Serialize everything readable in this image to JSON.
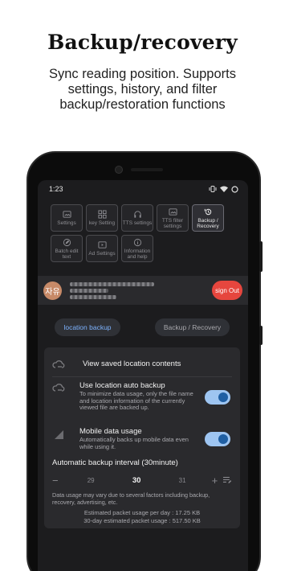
{
  "promo": {
    "title": "Backup/recovery",
    "subtitle": "Sync reading position. Supports settings, history, and filter backup/restoration functions"
  },
  "status_bar": {
    "time": "1:23"
  },
  "menu": {
    "items": [
      {
        "label": "Settings",
        "icon": "image-icon"
      },
      {
        "label": "key Setting",
        "icon": "grid-icon"
      },
      {
        "label": "TTS settings",
        "icon": "headphones-icon"
      },
      {
        "label": "TTS filter settings",
        "icon": "image-icon"
      },
      {
        "label": "Backup / Recovery",
        "icon": "restore-icon",
        "active": true
      },
      {
        "label": "Batch edit text",
        "icon": "edit-cycle-icon"
      },
      {
        "label": "Ad Settings",
        "icon": "play-box-icon"
      },
      {
        "label": "Information and help",
        "icon": "info-icon"
      }
    ]
  },
  "account": {
    "avatar_text": "자유",
    "sign_out_label": "sign Out"
  },
  "tabs": {
    "location_backup": "location backup",
    "backup_recovery": "Backup / Recovery"
  },
  "card": {
    "view_saved": "View saved location contents",
    "auto_backup": {
      "title": "Use location auto backup",
      "desc": "To minimize data usage, only the file name and location information of the currently viewed file are backed up.",
      "enabled": true
    },
    "mobile_data": {
      "title": "Mobile data usage",
      "desc": "Automatically backs up mobile data even while using it.",
      "enabled": true
    },
    "interval_title": "Automatic backup interval (30minute)",
    "interval": {
      "prev": "29",
      "current": "30",
      "next": "31"
    },
    "usage_note": "Data usage may vary due to several factors including backup, recovery, advertising, etc.",
    "per_day": "Estimated packet usage per day : 17.25 KB",
    "per_30_days": "30-day estimated packet usage : 517.50 KB"
  },
  "colors": {
    "accent_blue": "#7db3ff",
    "toggle_on": "#9ec5f1",
    "sign_out": "#e6463e",
    "screen_bg": "#1c1c1e"
  }
}
